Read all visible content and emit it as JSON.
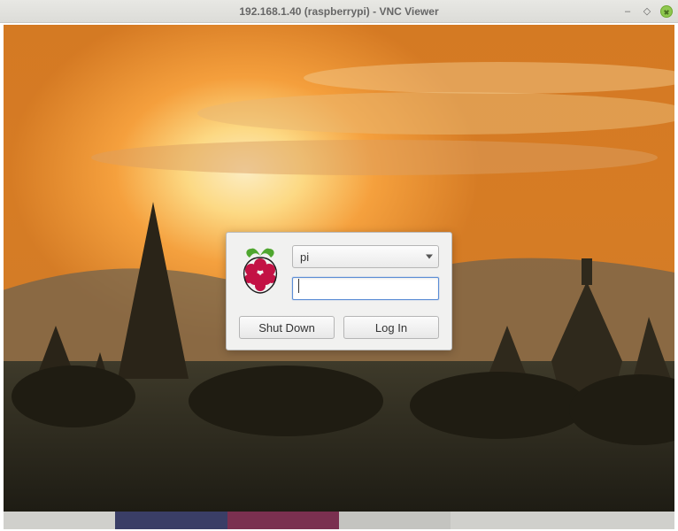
{
  "window": {
    "title": "192.168.1.40 (raspberrypi) - VNC Viewer"
  },
  "login": {
    "username": "pi",
    "password": "",
    "shutdown_label": "Shut Down",
    "login_label": "Log In"
  }
}
